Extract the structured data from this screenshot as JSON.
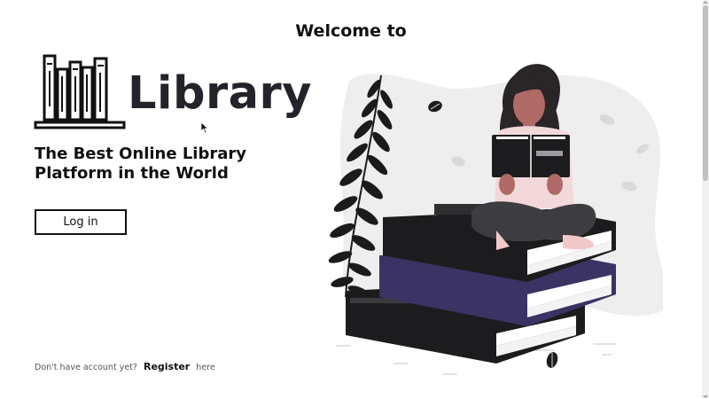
{
  "header": {
    "welcome": "Welcome to"
  },
  "brand": {
    "name": "Library",
    "icon": "bookshelf-icon"
  },
  "hero": {
    "tagline": "The Best Online Library Platform in the World"
  },
  "actions": {
    "login_label": "Log in"
  },
  "footer": {
    "prefix": "Don't have account yet?",
    "register_label": "Register",
    "suffix": "here"
  },
  "colors": {
    "text": "#111111",
    "book_black": "#1c1c1e",
    "book_purple": "#3a3363",
    "skin": "#b06a67",
    "blob": "#eeeeef"
  }
}
